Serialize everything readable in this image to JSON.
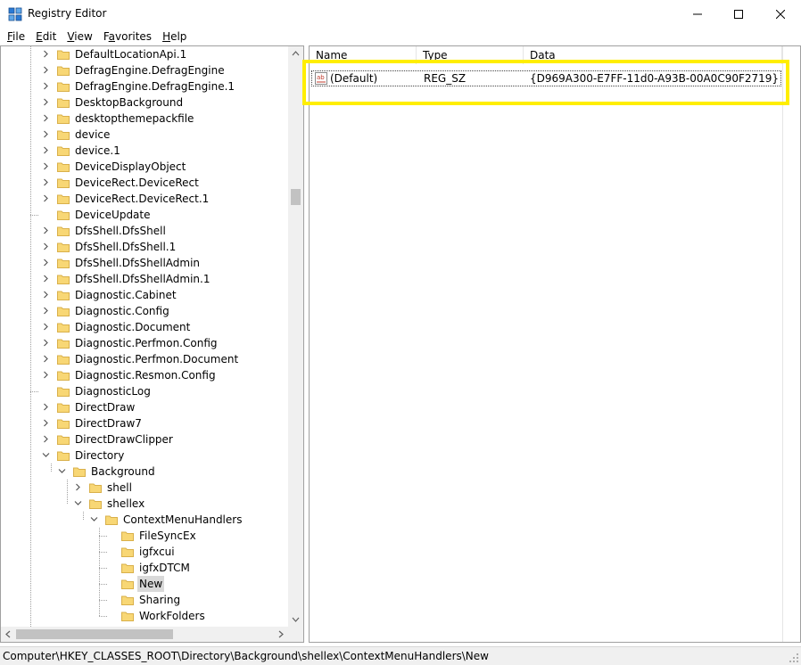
{
  "window": {
    "title": "Registry Editor",
    "icon": "registry-icon",
    "controls": {
      "minimize": "minimize-icon",
      "maximize": "maximize-icon",
      "close": "close-icon"
    }
  },
  "menu": {
    "items": [
      {
        "label": "File",
        "accel": "F",
        "rest": "ile"
      },
      {
        "label": "Edit",
        "accel": "E",
        "rest": "dit"
      },
      {
        "label": "View",
        "accel": "V",
        "rest": "iew"
      },
      {
        "label": "Favorites",
        "accel": "a",
        "pre": "F",
        "rest": "vorites"
      },
      {
        "label": "Help",
        "accel": "H",
        "rest": "elp"
      }
    ]
  },
  "tree": {
    "items": [
      {
        "label": "DefaultLocationApi.1",
        "level": 0,
        "expander": "collapsed"
      },
      {
        "label": "DefragEngine.DefragEngine",
        "level": 0,
        "expander": "collapsed"
      },
      {
        "label": "DefragEngine.DefragEngine.1",
        "level": 0,
        "expander": "collapsed"
      },
      {
        "label": "DesktopBackground",
        "level": 0,
        "expander": "collapsed"
      },
      {
        "label": "desktopthemepackfile",
        "level": 0,
        "expander": "collapsed"
      },
      {
        "label": "device",
        "level": 0,
        "expander": "collapsed"
      },
      {
        "label": "device.1",
        "level": 0,
        "expander": "collapsed"
      },
      {
        "label": "DeviceDisplayObject",
        "level": 0,
        "expander": "collapsed"
      },
      {
        "label": "DeviceRect.DeviceRect",
        "level": 0,
        "expander": "collapsed"
      },
      {
        "label": "DeviceRect.DeviceRect.1",
        "level": 0,
        "expander": "collapsed"
      },
      {
        "label": "DeviceUpdate",
        "level": 0,
        "expander": "none"
      },
      {
        "label": "DfsShell.DfsShell",
        "level": 0,
        "expander": "collapsed"
      },
      {
        "label": "DfsShell.DfsShell.1",
        "level": 0,
        "expander": "collapsed"
      },
      {
        "label": "DfsShell.DfsShellAdmin",
        "level": 0,
        "expander": "collapsed"
      },
      {
        "label": "DfsShell.DfsShellAdmin.1",
        "level": 0,
        "expander": "collapsed"
      },
      {
        "label": "Diagnostic.Cabinet",
        "level": 0,
        "expander": "collapsed"
      },
      {
        "label": "Diagnostic.Config",
        "level": 0,
        "expander": "collapsed"
      },
      {
        "label": "Diagnostic.Document",
        "level": 0,
        "expander": "collapsed"
      },
      {
        "label": "Diagnostic.Perfmon.Config",
        "level": 0,
        "expander": "collapsed"
      },
      {
        "label": "Diagnostic.Perfmon.Document",
        "level": 0,
        "expander": "collapsed"
      },
      {
        "label": "Diagnostic.Resmon.Config",
        "level": 0,
        "expander": "collapsed"
      },
      {
        "label": "DiagnosticLog",
        "level": 0,
        "expander": "none"
      },
      {
        "label": "DirectDraw",
        "level": 0,
        "expander": "collapsed"
      },
      {
        "label": "DirectDraw7",
        "level": 0,
        "expander": "collapsed"
      },
      {
        "label": "DirectDrawClipper",
        "level": 0,
        "expander": "collapsed"
      },
      {
        "label": "Directory",
        "level": 0,
        "expander": "expanded"
      },
      {
        "label": "Background",
        "level": 1,
        "expander": "expanded"
      },
      {
        "label": "shell",
        "level": 2,
        "expander": "collapsed"
      },
      {
        "label": "shellex",
        "level": 2,
        "expander": "expanded"
      },
      {
        "label": "ContextMenuHandlers",
        "level": 3,
        "expander": "expanded"
      },
      {
        "label": "FileSyncEx",
        "level": 4,
        "expander": "none"
      },
      {
        "label": "igfxcui",
        "level": 4,
        "expander": "none"
      },
      {
        "label": "igfxDTCM",
        "level": 4,
        "expander": "none"
      },
      {
        "label": "New",
        "level": 4,
        "expander": "none",
        "selected": true
      },
      {
        "label": "Sharing",
        "level": 4,
        "expander": "none"
      },
      {
        "label": "WorkFolders",
        "level": 4,
        "expander": "none"
      }
    ]
  },
  "list": {
    "columns": {
      "name": "Name",
      "type": "Type",
      "data": "Data"
    },
    "rows": [
      {
        "icon": "string-value-icon",
        "name": "(Default)",
        "type": "REG_SZ",
        "data": "{D969A300-E7FF-11d0-A93B-00A0C90F2719}"
      }
    ]
  },
  "status": {
    "path": "Computer\\HKEY_CLASSES_ROOT\\Directory\\Background\\shellex\\ContextMenuHandlers\\New"
  },
  "colors": {
    "highlight": "#ffee00",
    "folder": "#f8d775",
    "selection": "#d9d9d9"
  }
}
